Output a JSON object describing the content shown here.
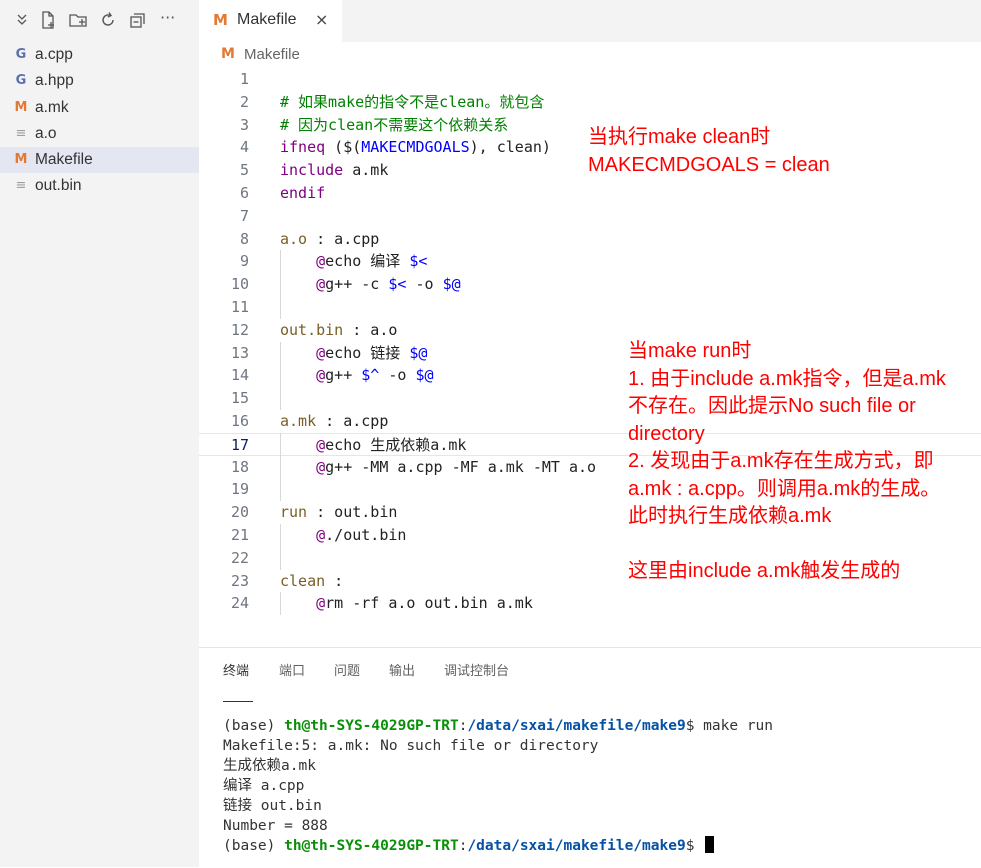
{
  "sidebar": {
    "toolbar_icons": [
      "collapse-chevron-icon",
      "new-file-icon",
      "new-folder-icon",
      "refresh-icon",
      "collapse-all-icon",
      "more-icon"
    ],
    "more_label": "···",
    "files": [
      {
        "name": "a.cpp",
        "icon": "cpp-file-icon",
        "glyph": "G"
      },
      {
        "name": "a.hpp",
        "icon": "hpp-file-icon",
        "glyph": "G"
      },
      {
        "name": "a.mk",
        "icon": "makefile-icon",
        "glyph": "M"
      },
      {
        "name": "a.o",
        "icon": "text-file-icon",
        "glyph": "≡"
      },
      {
        "name": "Makefile",
        "icon": "makefile-icon",
        "glyph": "M",
        "selected": true
      },
      {
        "name": "out.bin",
        "icon": "text-file-icon",
        "glyph": "≡"
      }
    ]
  },
  "tab": {
    "glyph": "M",
    "label": "Makefile",
    "close": "×"
  },
  "breadcrumb": {
    "glyph": "M",
    "label": "Makefile"
  },
  "editor": {
    "current_line": 17,
    "lines": [
      {
        "n": "1",
        "tokens": []
      },
      {
        "n": "2",
        "tokens": [
          {
            "t": "# 如果make的指令不是clean。就包含",
            "c": "comment"
          }
        ]
      },
      {
        "n": "3",
        "tokens": [
          {
            "t": "# 因为clean不需要这个依赖关系",
            "c": "comment"
          }
        ]
      },
      {
        "n": "4",
        "tokens": [
          {
            "t": "ifneq",
            "c": "keyword"
          },
          {
            "t": " ($(",
            "c": "normal"
          },
          {
            "t": "MAKECMDGOALS",
            "c": "variable"
          },
          {
            "t": "), clean)",
            "c": "normal"
          }
        ]
      },
      {
        "n": "5",
        "tokens": [
          {
            "t": "include",
            "c": "keyword"
          },
          {
            "t": " a.mk",
            "c": "normal"
          }
        ]
      },
      {
        "n": "6",
        "tokens": [
          {
            "t": "endif",
            "c": "keyword"
          }
        ]
      },
      {
        "n": "7",
        "tokens": []
      },
      {
        "n": "8",
        "tokens": [
          {
            "t": "a.o",
            "c": "target"
          },
          {
            "t": " : a.cpp",
            "c": "normal"
          }
        ]
      },
      {
        "n": "9",
        "tokens": [
          {
            "t": "    @",
            "c": "keyword"
          },
          {
            "t": "echo 编译 ",
            "c": "normal"
          },
          {
            "t": "$<",
            "c": "variable"
          }
        ]
      },
      {
        "n": "10",
        "tokens": [
          {
            "t": "    @",
            "c": "keyword"
          },
          {
            "t": "g++ -c ",
            "c": "normal"
          },
          {
            "t": "$<",
            "c": "variable"
          },
          {
            "t": " -o ",
            "c": "normal"
          },
          {
            "t": "$@",
            "c": "variable"
          }
        ]
      },
      {
        "n": "11",
        "tokens": []
      },
      {
        "n": "12",
        "tokens": [
          {
            "t": "out.bin",
            "c": "target"
          },
          {
            "t": " : a.o",
            "c": "normal"
          }
        ]
      },
      {
        "n": "13",
        "tokens": [
          {
            "t": "    @",
            "c": "keyword"
          },
          {
            "t": "echo 链接 ",
            "c": "normal"
          },
          {
            "t": "$@",
            "c": "variable"
          }
        ]
      },
      {
        "n": "14",
        "tokens": [
          {
            "t": "    @",
            "c": "keyword"
          },
          {
            "t": "g++ ",
            "c": "normal"
          },
          {
            "t": "$^",
            "c": "variable"
          },
          {
            "t": " -o ",
            "c": "normal"
          },
          {
            "t": "$@",
            "c": "variable"
          }
        ]
      },
      {
        "n": "15",
        "tokens": []
      },
      {
        "n": "16",
        "tokens": [
          {
            "t": "a.mk",
            "c": "target"
          },
          {
            "t": " : a.cpp",
            "c": "normal"
          }
        ]
      },
      {
        "n": "17",
        "tokens": [
          {
            "t": "    @",
            "c": "keyword"
          },
          {
            "t": "echo 生成依赖a.mk",
            "c": "normal"
          }
        ]
      },
      {
        "n": "18",
        "tokens": [
          {
            "t": "    @",
            "c": "keyword"
          },
          {
            "t": "g++ -MM a.cpp -MF a.mk -MT a.o",
            "c": "normal"
          }
        ]
      },
      {
        "n": "19",
        "tokens": []
      },
      {
        "n": "20",
        "tokens": [
          {
            "t": "run",
            "c": "target"
          },
          {
            "t": " : out.bin",
            "c": "normal"
          }
        ]
      },
      {
        "n": "21",
        "tokens": [
          {
            "t": "    @",
            "c": "keyword"
          },
          {
            "t": "./out.bin",
            "c": "normal"
          }
        ]
      },
      {
        "n": "22",
        "tokens": []
      },
      {
        "n": "23",
        "tokens": [
          {
            "t": "clean",
            "c": "target"
          },
          {
            "t": " :",
            "c": "normal"
          }
        ]
      },
      {
        "n": "24",
        "tokens": [
          {
            "t": "    @",
            "c": "keyword"
          },
          {
            "t": "rm -rf a.o out.bin a.mk",
            "c": "normal"
          }
        ]
      }
    ]
  },
  "annotations": {
    "note1": [
      "当执行make clean时",
      "MAKECMDGOALS = clean"
    ],
    "note2": [
      "当make run时",
      "1. 由于include a.mk指令，但是a.mk",
      "不存在。因此提示No such file or",
      "directory",
      "2. 发现由于a.mk存在生成方式，即",
      "a.mk : a.cpp。则调用a.mk的生成。",
      "此时执行生成依赖a.mk",
      "",
      "这里由include a.mk触发生成的"
    ]
  },
  "panel": {
    "tabs": [
      "终端",
      "端口",
      "问题",
      "输出",
      "调试控制台"
    ],
    "active_tab": "终端"
  },
  "terminal": {
    "prompt_prefix": "(base) ",
    "user_host": "th@th-SYS-4029GP-TRT",
    "colon": ":",
    "path": "/data/sxai/makefile/make9",
    "prompt_suffix": "$ ",
    "command": "make run",
    "output": [
      "Makefile:5: a.mk: No such file or directory",
      "生成依赖a.mk",
      "编译 a.cpp",
      "链接 out.bin",
      "Number = 888"
    ]
  },
  "colors": {
    "comment": "#008000",
    "keyword": "#800080",
    "variable": "#0000ff",
    "annotation": "#ff0000",
    "makefile_icon": "#e37933",
    "cpp_icon": "#5c6fb1",
    "selected_row": "#e4e6f1"
  }
}
